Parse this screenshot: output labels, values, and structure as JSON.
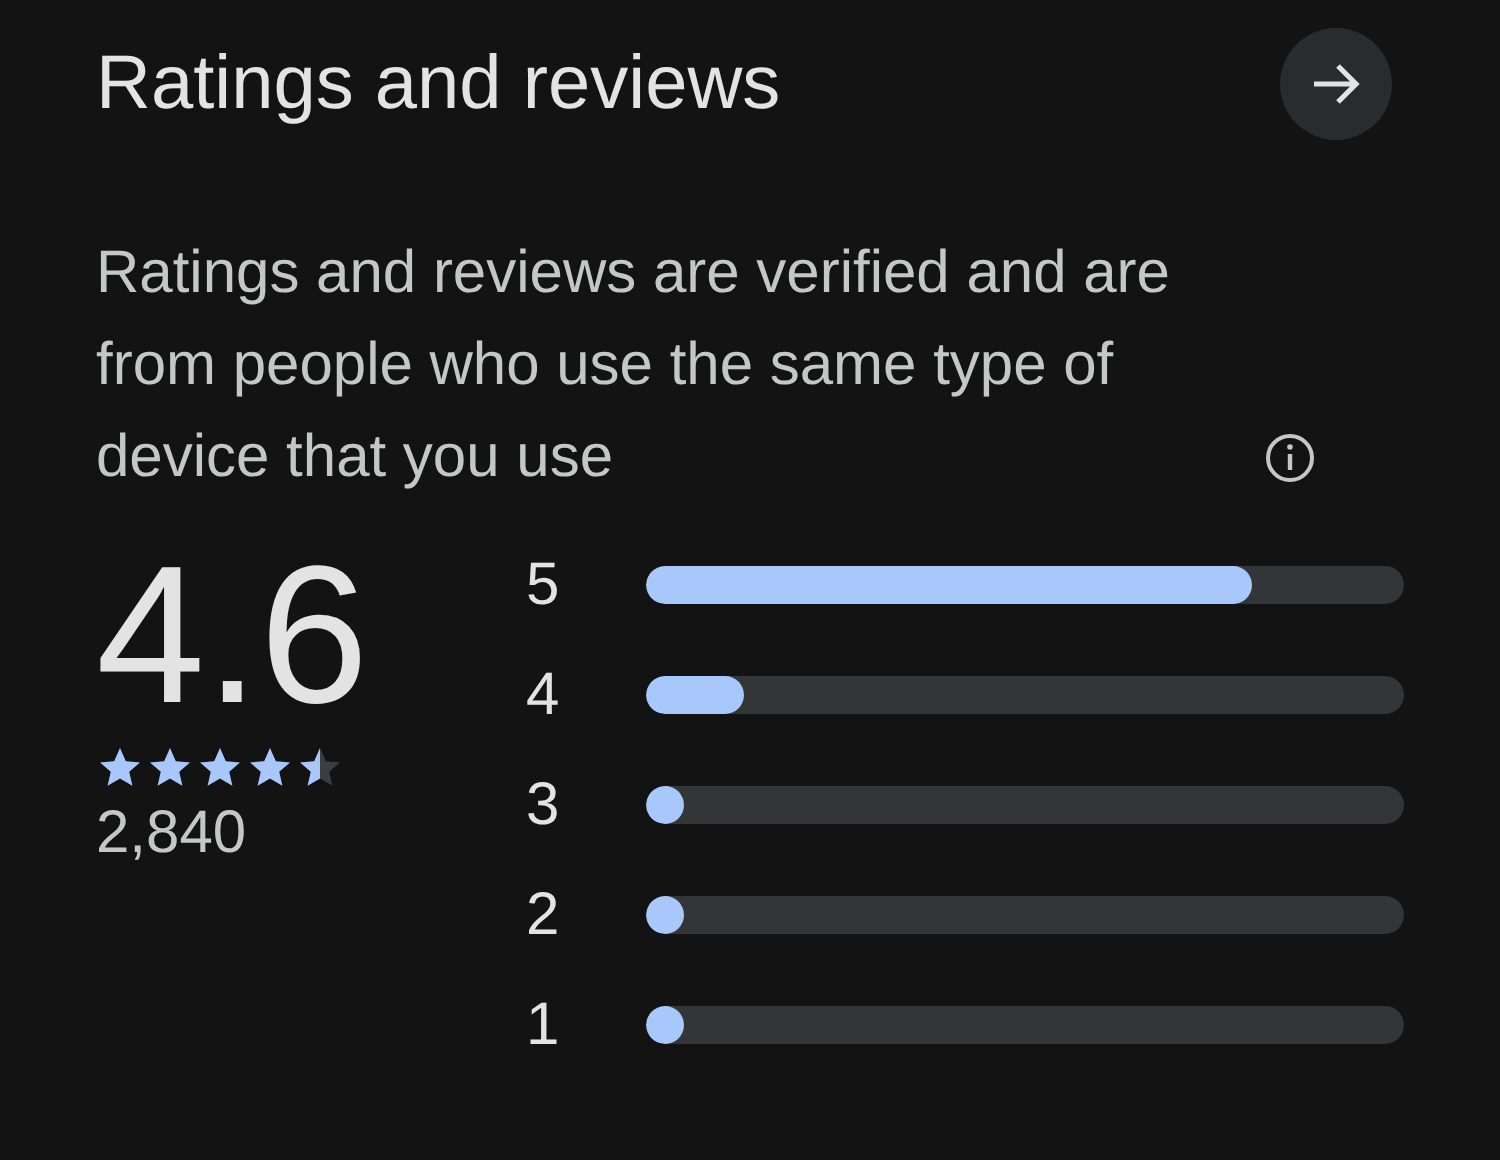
{
  "header": {
    "title": "Ratings and reviews"
  },
  "description": "Ratings and reviews are verified and are from people who use the same type of device that you use",
  "summary": {
    "rating": "4.6",
    "stars": 4.5,
    "count": "2,840"
  },
  "distribution": [
    {
      "label": "5",
      "level": 0.8
    },
    {
      "label": "4",
      "level": 0.13
    },
    {
      "label": "3",
      "level": 0.02
    },
    {
      "label": "2",
      "level": 0.02
    },
    {
      "label": "1",
      "level": 0.02
    }
  ]
}
